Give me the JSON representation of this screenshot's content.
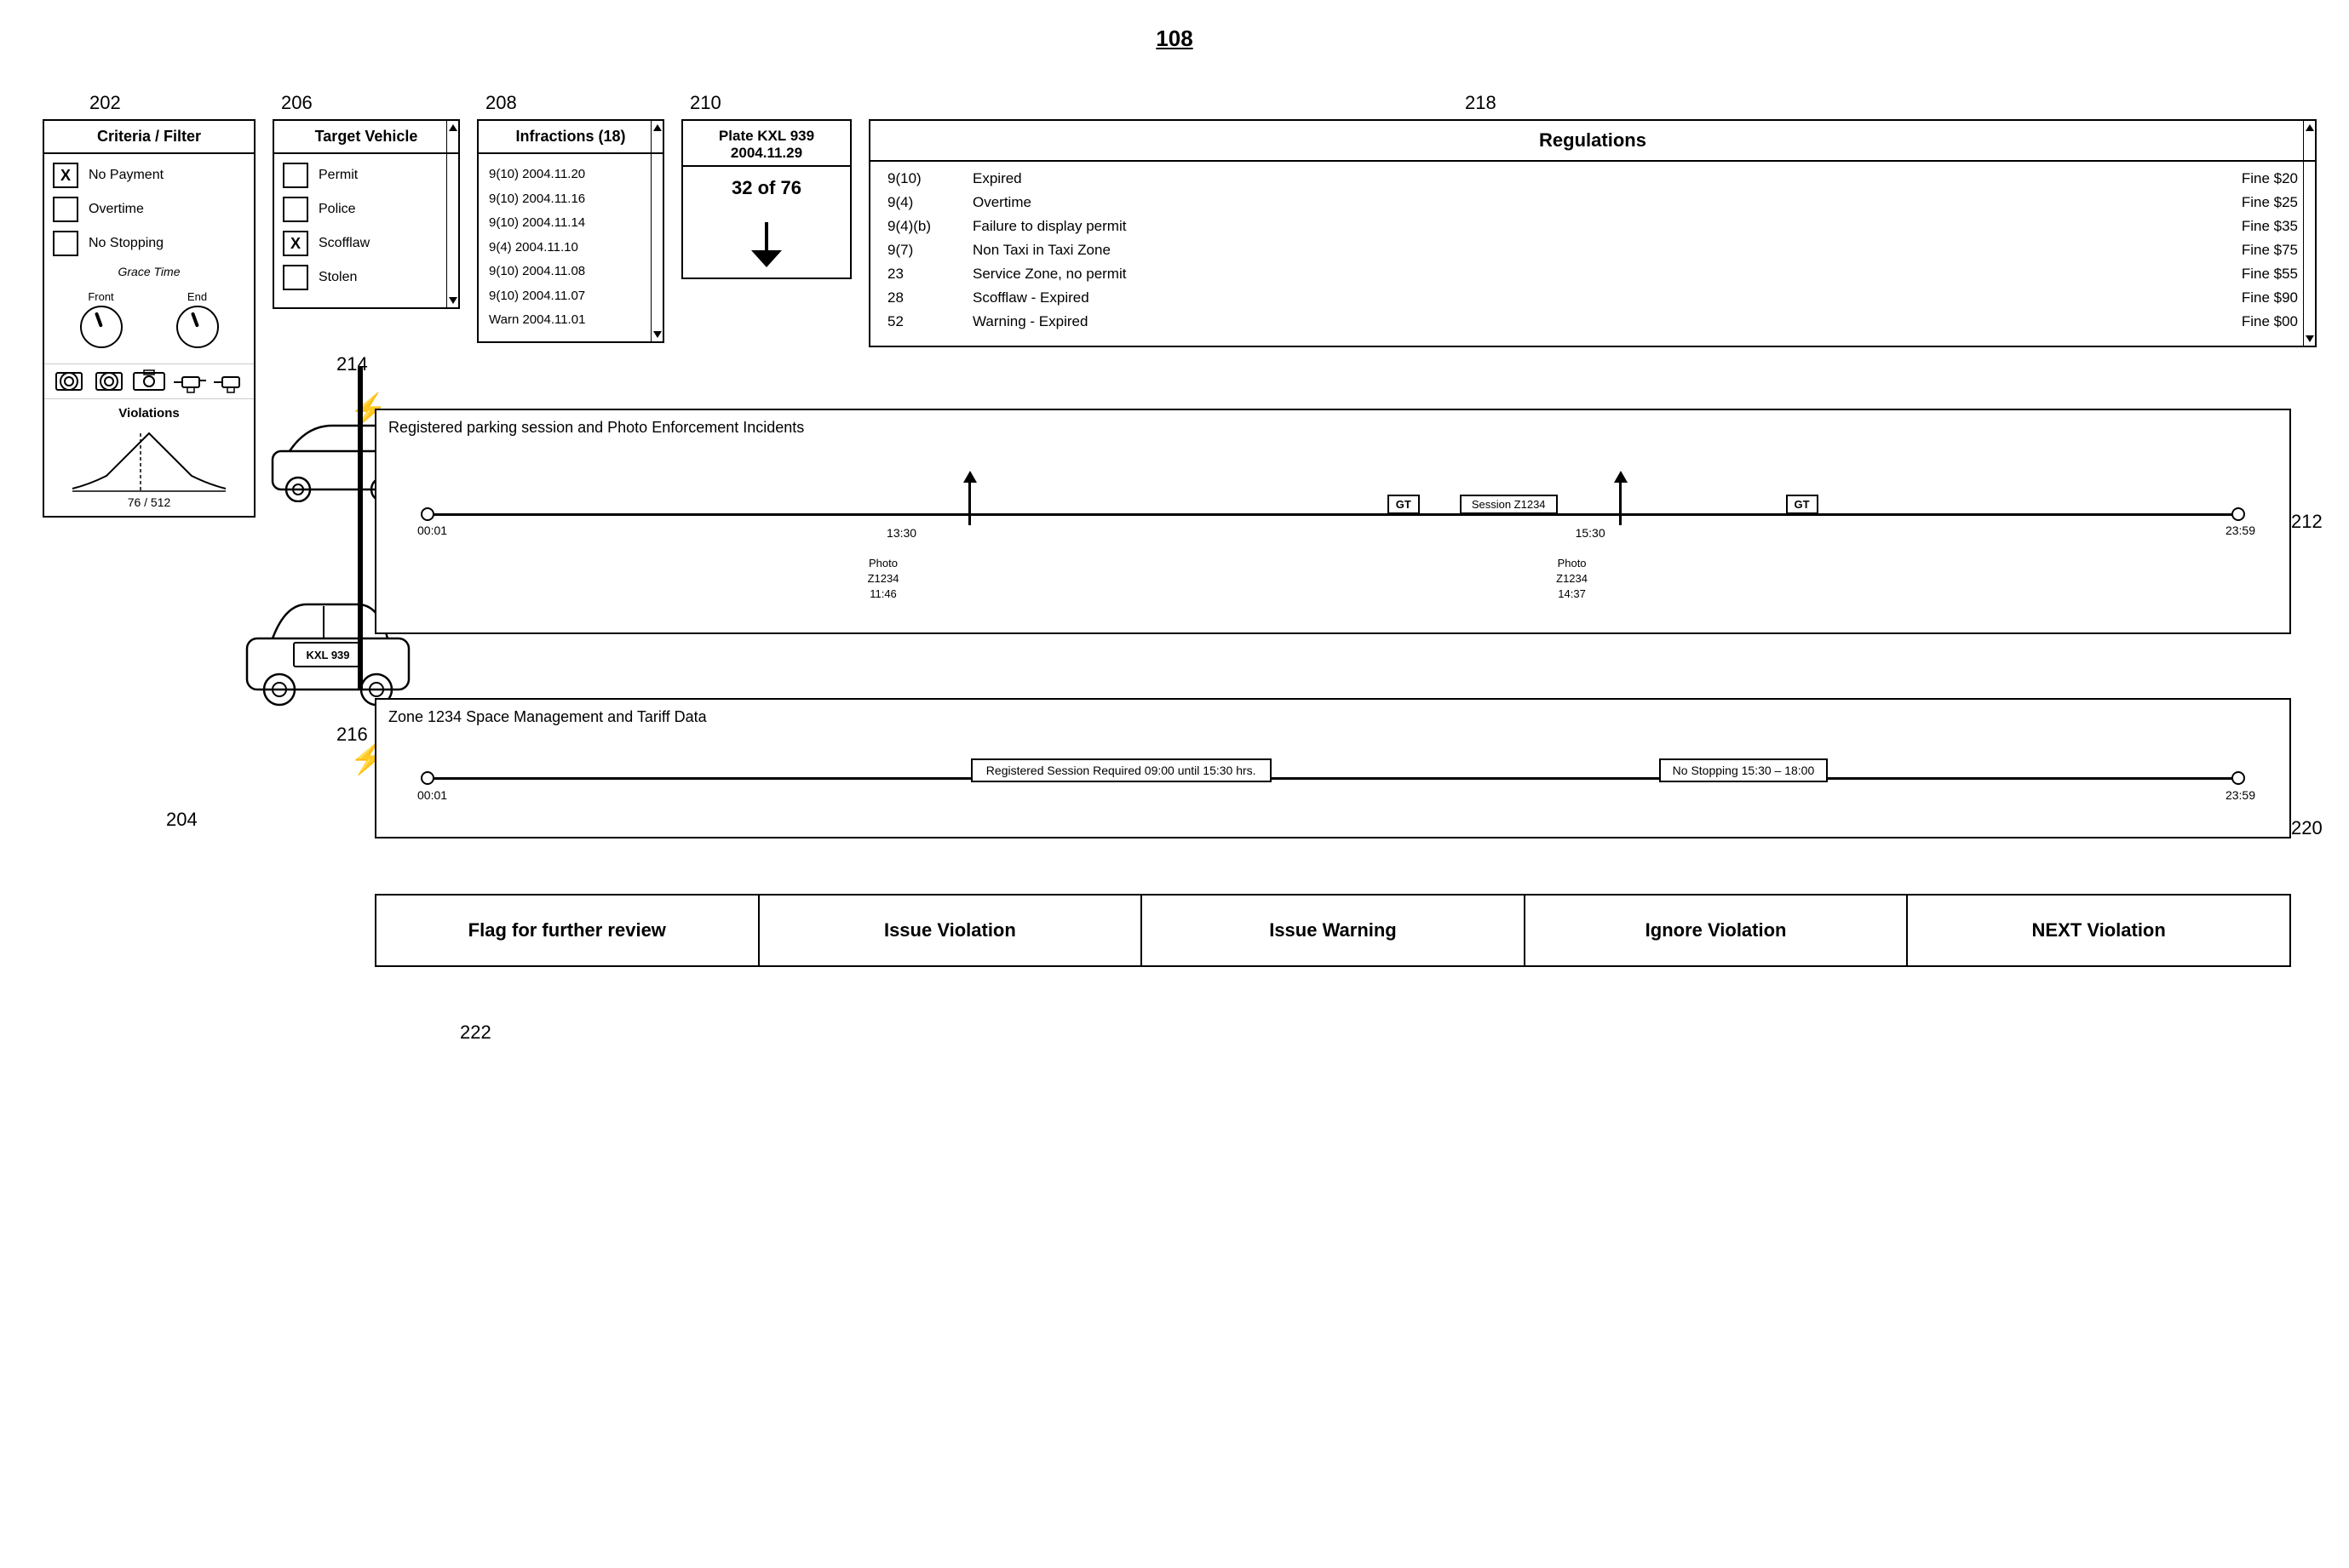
{
  "page": {
    "number": "108"
  },
  "refs": {
    "top": "108",
    "r202": "202",
    "r204": "204",
    "r206": "206",
    "r208": "208",
    "r210": "210",
    "r212": "212",
    "r214": "214",
    "r216": "216",
    "r218": "218",
    "r220": "220",
    "r222": "222"
  },
  "criteria_panel": {
    "title": "Criteria / Filter",
    "items": [
      {
        "checked": true,
        "label": "No Payment"
      },
      {
        "checked": false,
        "label": "Overtime"
      },
      {
        "checked": false,
        "label": "No Stopping"
      }
    ],
    "grace_time_label": "Grace Time",
    "front_label": "Front",
    "end_label": "End",
    "violations_title": "Violations",
    "violations_count": "76 / 512"
  },
  "target_panel": {
    "title": "Target Vehicle",
    "items": [
      {
        "checked": false,
        "label": "Permit"
      },
      {
        "checked": false,
        "label": "Police"
      },
      {
        "checked": true,
        "label": "Scofflaw"
      },
      {
        "checked": false,
        "label": "Stolen"
      }
    ]
  },
  "infractions_panel": {
    "title": "Infractions (18)",
    "items": [
      "9(10)  2004.11.20",
      "9(10)  2004.11.16",
      "9(10)  2004.11.14",
      "9(4)   2004.11.10",
      "9(10)  2004.11.08",
      "9(10)  2004.11.07",
      "Warn 2004.11.01"
    ]
  },
  "plate_panel": {
    "title_line1": "Plate KXL 939",
    "title_line2": "2004.11.29",
    "count": "32 of 76"
  },
  "regulations_panel": {
    "title": "Regulations",
    "rows": [
      {
        "code": "9(10)",
        "desc": "Expired",
        "fine": "Fine $20"
      },
      {
        "code": "9(4)",
        "desc": "Overtime",
        "fine": "Fine $25"
      },
      {
        "code": "9(4)(b)",
        "desc": "Failure to display permit",
        "fine": "Fine $35"
      },
      {
        "code": "9(7)",
        "desc": "Non Taxi in Taxi Zone",
        "fine": "Fine $75"
      },
      {
        "code": "23",
        "desc": "Service Zone, no permit",
        "fine": "Fine $55"
      },
      {
        "code": "28",
        "desc": "Scofflaw - Expired",
        "fine": "Fine $90"
      },
      {
        "code": "52",
        "desc": "Warning - Expired",
        "fine": "Fine $00"
      }
    ]
  },
  "session_panel": {
    "title": "Registered parking session and Photo Enforcement Incidents",
    "time_start": "00:01",
    "time_end": "23:59",
    "gt_label1": "GT",
    "session_label": "Session Z1234",
    "gt_label2": "GT",
    "time_1330": "13:30",
    "time_1530": "15:30",
    "photo1_label": "Photo\nZ1234\n11:46",
    "photo2_label": "Photo\nZ1234\n14:37"
  },
  "zone_panel": {
    "title": "Zone 1234 Space Management and Tariff Data",
    "time_start": "00:01",
    "time_end": "23:59",
    "session_box": "Registered Session Required 09:00 until 15:30 hrs.",
    "nostopping_box": "No Stopping 15:30 – 18:00"
  },
  "action_buttons": [
    {
      "label": "Flag for further review"
    },
    {
      "label": "Issue Violation"
    },
    {
      "label": "Issue Warning"
    },
    {
      "label": "Ignore Violation"
    },
    {
      "label": "NEXT Violation"
    }
  ]
}
